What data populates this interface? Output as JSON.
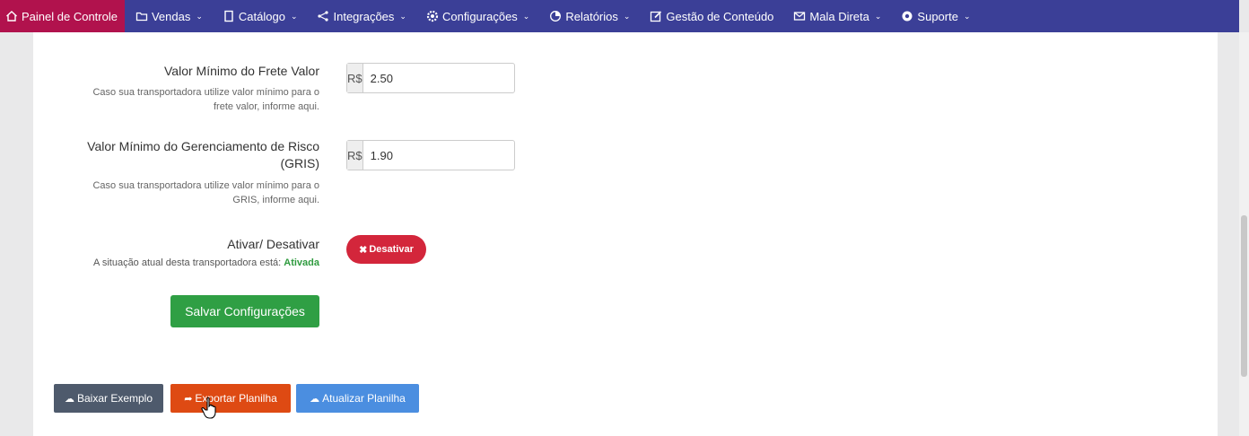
{
  "nav": {
    "items": [
      {
        "label": "Painel de Controle",
        "icon": "home-icon",
        "caret": false
      },
      {
        "label": "Vendas",
        "icon": "folder-icon",
        "caret": true
      },
      {
        "label": "Catálogo",
        "icon": "book-icon",
        "caret": true
      },
      {
        "label": "Integrações",
        "icon": "share-icon",
        "caret": true
      },
      {
        "label": "Configurações",
        "icon": "gear-icon",
        "caret": true
      },
      {
        "label": "Relatórios",
        "icon": "chart-icon",
        "caret": true
      },
      {
        "label": "Gestão de Conteúdo",
        "icon": "edit-icon",
        "caret": false
      },
      {
        "label": "Mala Direta",
        "icon": "envelope-icon",
        "caret": true
      },
      {
        "label": "Suporte",
        "icon": "lifebuoy-icon",
        "caret": true
      }
    ]
  },
  "form": {
    "frete_valor": {
      "label": "Valor Mínimo do Frete Valor",
      "help_line1": "Caso sua transportadora utilize valor mínimo para o",
      "help_line2": "frete valor, informe aqui.",
      "addon": "R$",
      "value": "2.50"
    },
    "gris": {
      "label_line1": "Valor Mínimo do Gerenciamento de Risco",
      "label_line2": "(GRIS)",
      "help_line1": "Caso sua transportadora utilize valor mínimo para o",
      "help_line2": "GRIS, informe aqui.",
      "addon": "R$",
      "value": "1.90"
    },
    "status": {
      "label": "Ativar/ Desativar",
      "description": "A situação atual desta transportadora está:",
      "value": "Ativada",
      "toggle_button": "Desativar"
    },
    "save_button": "Salvar Configurações"
  },
  "actions": {
    "baixar": "Baixar Exemplo",
    "exportar": "Exportar Planilha",
    "atualizar": "Atualizar Planilha"
  },
  "colors": {
    "navbar": "#3b3f97",
    "nav_active": "#b1124d",
    "danger": "#d3263b",
    "success": "#2f9f44",
    "export": "#de4a13",
    "update": "#4b8ee0",
    "neutral": "#4e5a6c"
  }
}
